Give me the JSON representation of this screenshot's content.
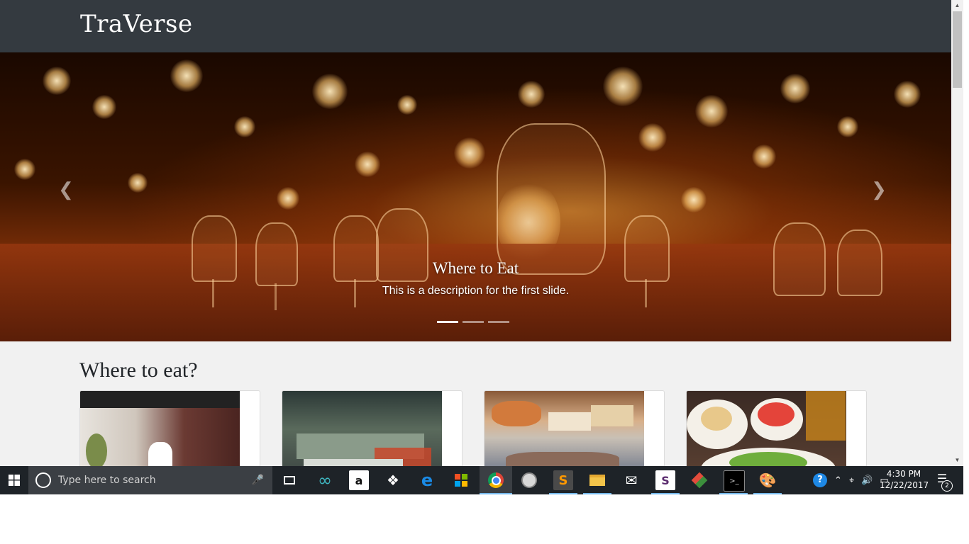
{
  "navbar": {
    "brand": "TraVerse"
  },
  "carousel": {
    "caption_title": "Where to Eat",
    "caption_description": "This is a description for the first slide.",
    "slide_count": 3,
    "active_slide": 1,
    "prev_icon": "chevron-left-icon",
    "next_icon": "chevron-right-icon"
  },
  "section": {
    "title": "Where to eat?"
  },
  "cards": [
    {
      "image": "restaurant-interior-photo"
    },
    {
      "image": "cafe-dining-room-photo"
    },
    {
      "image": "bakery-display-photo"
    },
    {
      "image": "food-dishes-photo"
    }
  ],
  "taskbar": {
    "search_placeholder": "Type here to search",
    "apps": [
      "task-view-icon",
      "infinity-app-icon",
      "amazon-icon",
      "dropbox-icon",
      "edge-icon",
      "store-icon",
      "chrome-icon",
      "app-icon",
      "sublime-text-icon",
      "file-explorer-icon",
      "mail-icon",
      "slack-icon",
      "git-icon",
      "terminal-icon",
      "paint-icon"
    ],
    "time": "4:30 PM",
    "date": "12/22/2017",
    "notification_count": "2"
  },
  "colors": {
    "navbar_bg": "#343a40",
    "page_bg": "#f1f1f1",
    "taskbar_bg": "#1e2328",
    "accent": "#76b9ed"
  }
}
